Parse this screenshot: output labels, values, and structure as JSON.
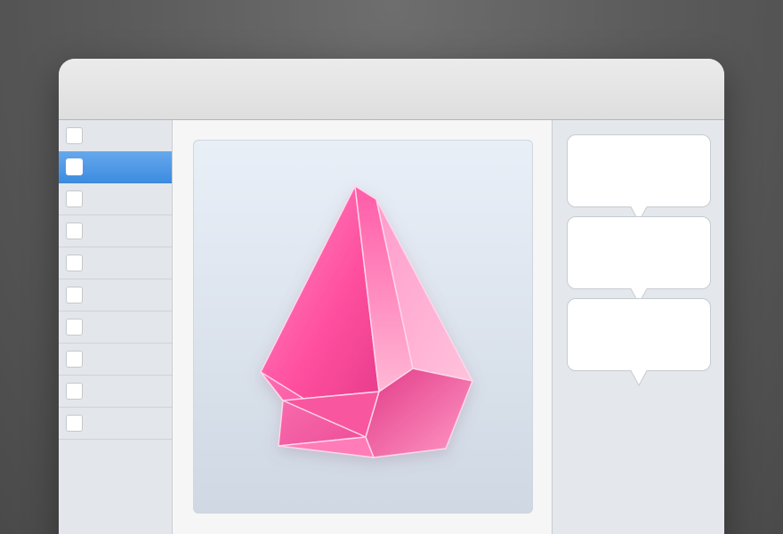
{
  "window": {
    "title": ""
  },
  "sidebar": {
    "rows": [
      {
        "checked": false,
        "selected": false
      },
      {
        "checked": false,
        "selected": true
      },
      {
        "checked": false,
        "selected": false
      },
      {
        "checked": false,
        "selected": false
      },
      {
        "checked": false,
        "selected": false
      },
      {
        "checked": false,
        "selected": false
      },
      {
        "checked": false,
        "selected": false
      },
      {
        "checked": false,
        "selected": false
      },
      {
        "checked": false,
        "selected": false
      },
      {
        "checked": false,
        "selected": false
      }
    ],
    "selected_color": "#4a95e4"
  },
  "preview": {
    "icon": "pink-crystal-gem-icon",
    "gem_color": "#ff5fa6"
  },
  "inspector": {
    "bubbles": [
      {
        "text": ""
      },
      {
        "text": ""
      },
      {
        "text": ""
      }
    ]
  }
}
